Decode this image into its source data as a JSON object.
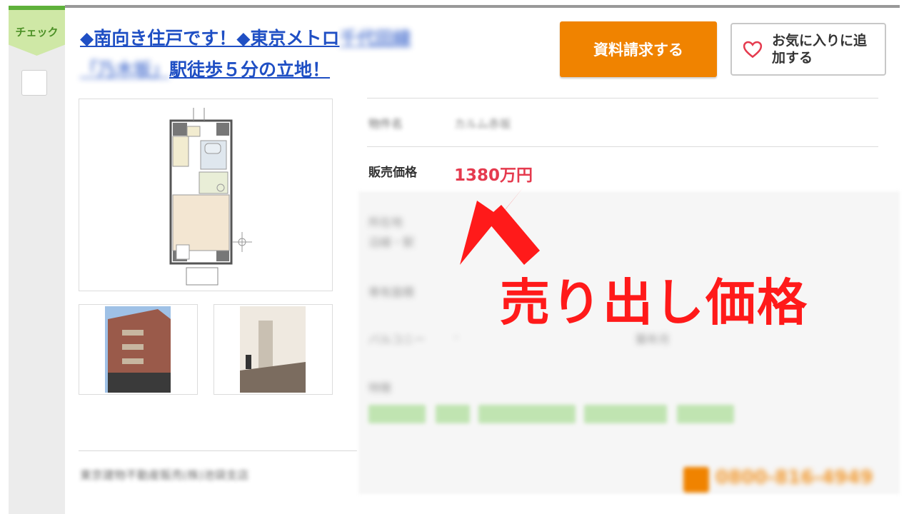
{
  "sidebar": {
    "check_label": "チェック"
  },
  "listing": {
    "title_visible_1": "◆南向き住戸です！◆東京メトロ",
    "title_blurred_1": "千代田線",
    "title_blurred_2": "「乃木坂」",
    "title_visible_2": "駅徒歩５分の立地！",
    "request_button": "資料請求する",
    "favorite_button": "お気に入りに追加する",
    "property_name_label": "物件名",
    "property_name_value": "カルム赤坂",
    "price_label": "販売価格",
    "price_value": "1380万円",
    "location_label": "所在地",
    "access_label": "沿線・駅",
    "area_label": "専有面積",
    "balcony_label": "バルコニー",
    "balcony_value": "-",
    "built_label": "築年月",
    "features_label": "特徴",
    "company": "東京建物不動産販売(株)池袋支店",
    "phone": "0800-816-4949"
  },
  "annotation": {
    "text": "売り出し価格"
  },
  "colors": {
    "accent_orange": "#f08300",
    "price_red": "#e53a4e",
    "annotation_red": "#ff1a1a",
    "link_blue": "#1f4fc4"
  }
}
